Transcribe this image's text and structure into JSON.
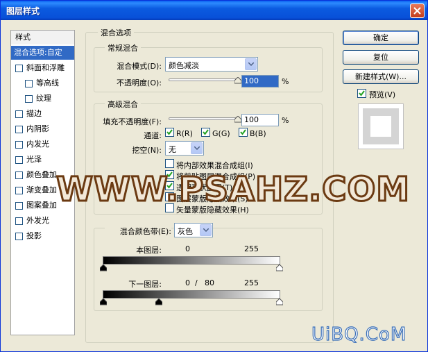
{
  "window": {
    "title": "图层样式"
  },
  "style_list": {
    "header": "样式",
    "items": [
      {
        "label": "混合选项:自定",
        "type": "selected",
        "checked": false
      },
      {
        "label": "斜面和浮雕",
        "type": "check",
        "checked": false
      },
      {
        "label": "等高线",
        "type": "subcheck",
        "checked": false
      },
      {
        "label": "纹理",
        "type": "subcheck",
        "checked": false
      },
      {
        "label": "描边",
        "type": "check",
        "checked": false
      },
      {
        "label": "内阴影",
        "type": "check",
        "checked": false
      },
      {
        "label": "内发光",
        "type": "check",
        "checked": false
      },
      {
        "label": "光泽",
        "type": "check",
        "checked": false
      },
      {
        "label": "颜色叠加",
        "type": "check",
        "checked": false
      },
      {
        "label": "渐变叠加",
        "type": "check",
        "checked": false
      },
      {
        "label": "图案叠加",
        "type": "check",
        "checked": false
      },
      {
        "label": "外发光",
        "type": "check",
        "checked": false
      },
      {
        "label": "投影",
        "type": "check",
        "checked": false
      }
    ]
  },
  "blend_options": {
    "legend": "混合选项",
    "general": {
      "legend": "常规混合",
      "mode_label": "混合模式(D):",
      "mode_value": "颜色减淡",
      "opacity_label": "不透明度(O):",
      "opacity_value": "100",
      "opacity_unit": "%",
      "opacity_fraction": 1.0
    },
    "advanced": {
      "legend": "高级混合",
      "fill_label": "填充不透明度(F):",
      "fill_value": "100",
      "fill_unit": "%",
      "fill_fraction": 1.0,
      "channels_label": "通道:",
      "channels": [
        {
          "label": "R(R)",
          "checked": true
        },
        {
          "label": "G(G)",
          "checked": true
        },
        {
          "label": "B(B)",
          "checked": true
        }
      ],
      "knockout_label": "挖空(N):",
      "knockout_value": "无",
      "options": [
        {
          "label": "将内部效果混合成组(I)",
          "checked": false
        },
        {
          "label": "将剪贴图层混合成组(P)",
          "checked": true
        },
        {
          "label": "透明形状图层(T)",
          "checked": true
        },
        {
          "label": "图层蒙版隐藏效果(S)",
          "checked": false
        },
        {
          "label": "矢量蒙版隐藏效果(H)",
          "checked": false
        }
      ]
    },
    "blend_if": {
      "label": "混合颜色带(E):",
      "value": "灰色",
      "this_layer": {
        "label": "本图层:",
        "low": "0",
        "high": "255",
        "low_value": 0,
        "high_value": 255
      },
      "underlying": {
        "label": "下一图层:",
        "low": "0",
        "sep": "/",
        "low2": "80",
        "high": "255",
        "low_value": 0,
        "split_value": 80,
        "high_value": 255
      }
    }
  },
  "buttons": {
    "ok": "确定",
    "reset": "复位",
    "new_style": "新建样式(W)...",
    "preview_label": "预览(V)",
    "preview_checked": true
  },
  "watermarks": {
    "main": "WWW.PSAHZ.COM",
    "corner": "UiBQ.CoM"
  }
}
